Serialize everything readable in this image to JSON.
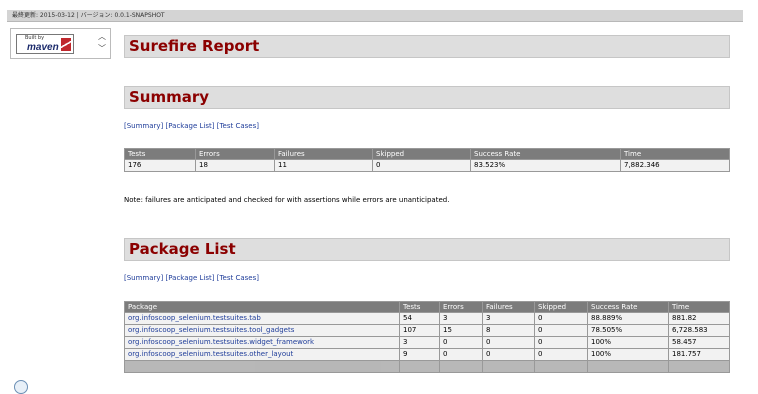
{
  "topbar": {
    "text": "最終更新: 2015-03-12 | バージョン: 0.0.1-SNAPSHOT"
  },
  "leftnav": {
    "badge_small": "Built by",
    "badge_logo": "maven"
  },
  "sections": {
    "report_title": "Surefire Report",
    "summary_title": "Summary",
    "package_list_title": "Package List"
  },
  "nav_links": {
    "summary": "[Summary]",
    "package_list": "[Package List]",
    "test_cases": "[Test Cases]"
  },
  "summary_table": {
    "headers": [
      "Tests",
      "Errors",
      "Failures",
      "Skipped",
      "Success Rate",
      "Time"
    ],
    "row": [
      "176",
      "18",
      "11",
      "0",
      "83.523%",
      "7,882.346"
    ]
  },
  "note": "Note: failures are anticipated and checked for with assertions while errors are unanticipated.",
  "package_table": {
    "headers": [
      "Package",
      "Tests",
      "Errors",
      "Failures",
      "Skipped",
      "Success Rate",
      "Time"
    ],
    "rows": [
      [
        "org.infoscoop_selenium.testsuites.tab",
        "54",
        "3",
        "3",
        "0",
        "88.889%",
        "881.82"
      ],
      [
        "org.infoscoop_selenium.testsuites.tool_gadgets",
        "107",
        "15",
        "8",
        "0",
        "78.505%",
        "6,728.583"
      ],
      [
        "org.infoscoop_selenium.testsuites.widget_framework",
        "3",
        "0",
        "0",
        "0",
        "100%",
        "58.457"
      ],
      [
        "org.infoscoop_selenium.testsuites.other_layout",
        "9",
        "0",
        "0",
        "0",
        "100%",
        "181.757"
      ]
    ]
  }
}
